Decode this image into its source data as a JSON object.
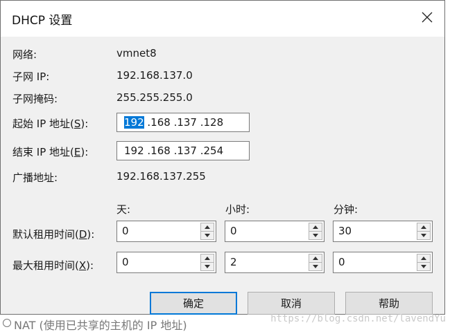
{
  "dialog": {
    "title": "DHCP 设置",
    "close_glyph": "✕"
  },
  "info": {
    "network_label": "网络:",
    "network_value": "vmnet8",
    "subnet_ip_label": "子网 IP:",
    "subnet_ip_value": "192.168.137.0",
    "subnet_mask_label": "子网掩码:",
    "subnet_mask_value": "255.255.255.0",
    "broadcast_label": "广播地址:",
    "broadcast_value": "192.168.137.255"
  },
  "start_ip": {
    "label_pre": "起始 IP 地址(",
    "label_key": "S",
    "label_post": "):",
    "octet_selected": "192",
    "rest": " .168 .137 .128"
  },
  "end_ip": {
    "label_pre": "结束 IP 地址(",
    "label_key": "E",
    "label_post": "):",
    "value": "192 .168 .137 .254"
  },
  "lease": {
    "col_days": "天:",
    "col_hours": "小时:",
    "col_minutes": "分钟:",
    "default_label_pre": "默认租用时间(",
    "default_label_key": "D",
    "default_label_post": "):",
    "max_label_pre": "最大租用时间(",
    "max_label_key": "X",
    "max_label_post": "):",
    "default_days": "0",
    "default_hours": "0",
    "default_minutes": "30",
    "max_days": "0",
    "max_hours": "2",
    "max_minutes": "0"
  },
  "buttons": {
    "ok": "确定",
    "cancel": "取消",
    "help": "帮助"
  },
  "background": {
    "partial_text": "NAT (使用已共享的主机的 IP 地址)",
    "watermark": "https://blog.csdn.net/lavendYu"
  },
  "colors": {
    "accent": "#0078d7",
    "dialog_bg": "#f0f0f0"
  }
}
